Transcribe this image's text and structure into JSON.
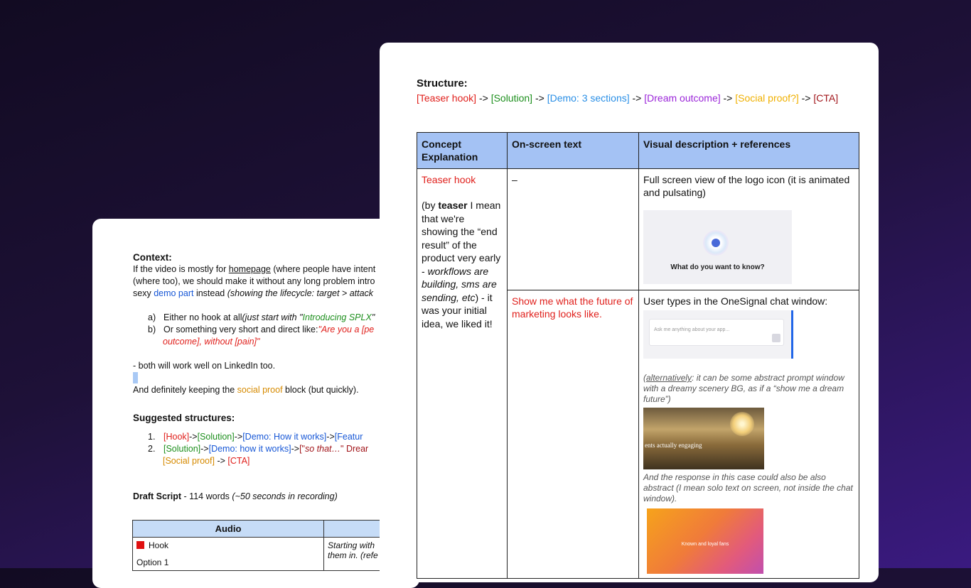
{
  "back": {
    "context_title": "Context:",
    "context_lines": [
      [
        "If the video is mostly for ",
        "homepage",
        " (where people have intent"
      ],
      [
        "(where too), we should make it without any long problem intro"
      ],
      [
        "sexy ",
        "demo part",
        " instead ",
        "(showing the lifecycle: target > attack"
      ]
    ],
    "options": [
      {
        "label": "a)",
        "text": "Either no hook at all ",
        "italic": "(just start with \"",
        "green": "Introducing SPLX",
        "end": "\""
      },
      {
        "label": "b)",
        "text": "Or something very short and direct like: ",
        "red": "\"Are you a [pe",
        "red2": "outcome], without [pain]\""
      }
    ],
    "linkedin": "- both will work well on LinkedIn too.",
    "keeping": [
      "And definitely keeping the ",
      "social proof",
      " block (but quickly)."
    ],
    "suggested_title": "Suggested structures:",
    "s1": {
      "n": "1.",
      "parts": [
        "[Hook]",
        " -> ",
        "[Solution]",
        " -> ",
        "[Demo: How it works]",
        " -> ",
        "[Featur"
      ]
    },
    "s2": {
      "n": "2.",
      "parts": [
        "[Solution]",
        " -> ",
        "[Demo: how it works]",
        " -> ",
        "[\"",
        "so that…",
        "\" Drear"
      ],
      "line2": [
        "[Social proof]",
        " -> ",
        "[CTA]"
      ]
    },
    "draft": {
      "title": "Draft Script",
      "rest": " - 114 words ",
      "italic": "(~50 seconds in recording)"
    },
    "table": {
      "header": "Audio",
      "hook": "Hook",
      "option": "Option 1",
      "right1": "Starting with",
      "right2": "them in. (refe"
    }
  },
  "front": {
    "structure_title": "Structure:",
    "structure": [
      "[Teaser hook]",
      " -> ",
      "[Solution]",
      " -> ",
      "[Demo: 3 sections]",
      " -> ",
      "[Dream outcome]",
      " -> ",
      "[Social proof?]",
      " -> ",
      "[CTA]"
    ],
    "headers": [
      "Concept Explanation",
      "On-screen text",
      "Visual description + references"
    ],
    "row1": {
      "concept_title": "Teaser hook",
      "concept_body": [
        "(by ",
        "teaser",
        " I mean that we're showing the “end result” of the product very early - ",
        "workflows are building, sms are sending, etc",
        ") - it was your initial idea, we liked it!"
      ],
      "onscreen": "–",
      "visual": "Full screen view of the logo icon (it is animated and pulsating)",
      "img_caption": "What do you want to know?"
    },
    "row2": {
      "onscreen": "Show me what the future of marketing looks like.",
      "visual": "User types in the OneSignal chat window:",
      "chat_placeholder": "Ask me anything about your app...",
      "note1_u": "alternatively",
      "note1": ": it can be some abstract prompt window with a dreamy scenery BG, as if a “show me a dream future”)",
      "sunset_text": "ents actually engaging",
      "note2": "And the response in this case could also be also abstract (I mean solo text on screen, not inside the chat window).",
      "orange_text": "Known and loyal fans"
    }
  },
  "colors": {
    "teaser": "#e0201c",
    "solution": "#1d8f1d",
    "demo": "#2a8fe6",
    "dream": "#9b26d9",
    "social": "#f0b000",
    "cta": "#a1151a",
    "header_bg": "#a4c2f4"
  }
}
